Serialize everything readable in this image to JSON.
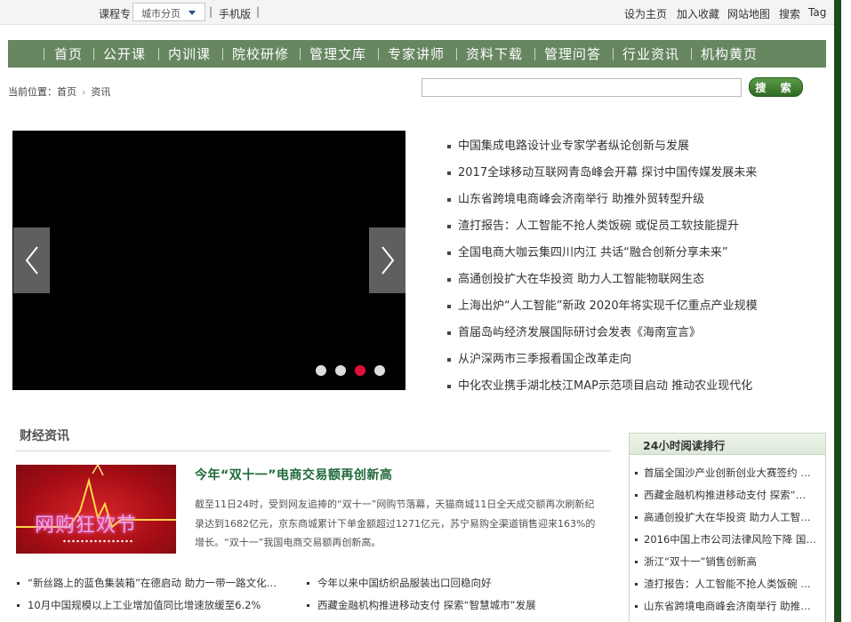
{
  "topbar": {
    "left_text": "课程专",
    "city_dropdown": "城市分页",
    "mobile": "手机版",
    "right_links": [
      "设为主页",
      "加入收藏",
      "网站地图",
      "搜索",
      "Tag"
    ]
  },
  "nav": {
    "items": [
      "首页",
      "公开课",
      "内训课",
      "院校研修",
      "管理文库",
      "专家讲师",
      "资料下载",
      "管理问答",
      "行业资讯",
      "机构黄页"
    ]
  },
  "breadcrumb": {
    "label": "当前位置：",
    "home": "首页",
    "current": "资讯"
  },
  "search": {
    "button": "搜 索"
  },
  "headlines": [
    "中国集成电路设计业专家学者纵论创新与发展",
    "2017全球移动互联网青岛峰会开幕 探讨中国传媒发展未来",
    "山东省跨境电商峰会济南举行 助推外贸转型升级",
    "渣打报告：人工智能不抢人类饭碗 或促员工软技能提升",
    "全国电商大咖云集四川内江 共话“融合创新分享未来”",
    "高通创投扩大在华投资 助力人工智能物联网生态",
    "上海出炉“人工智能”新政 2020年将实现千亿重点产业规模",
    "首届岛屿经济发展国际研讨会发表《海南宣言》",
    "从沪深两市三季报看国企改革走向",
    "中化农业携手湖北枝江MAP示范项目启动 推动农业现代化"
  ],
  "finance": {
    "section_title": "财经资讯",
    "image_text": "网购狂欢节",
    "feature_title": "今年“双十一”电商交易额再创新高",
    "feature_body": "截至11日24时，受到网友追捧的“双十一”网购节落幕，天猫商城11日全天成交额再次刷新纪录达到1682亿元，京东商城累计下单金额超过1271亿元，苏宁易购全渠道销售迎来163%的增长。“双十一”我国电商交易额再创新高。",
    "list_left": [
      "“新丝路上的蓝色集装箱”在德启动 助力一带一路文化…",
      "10月中国规模以上工业增加值同比增速放缓至6.2%"
    ],
    "list_right": [
      "今年以来中国纺织品服装出口回稳向好",
      "西藏金融机构推进移动支付 探索“智慧城市”发展"
    ]
  },
  "ranking": {
    "title": "24小时阅读排行",
    "items": [
      "首届全国沙产业创新创业大赛签约 …",
      "西藏金融机构推进移动支付 探索“…",
      "高通创投扩大在华投资 助力人工智…",
      "2016中国上市公司法律风险下降 国…",
      "浙江“双十一”销售创新高",
      "渣打报告：人工智能不抢人类饭碗 …",
      "山东省跨境电商峰会济南举行 助推…"
    ]
  },
  "slider": {
    "active_index": 2,
    "dot_count": 4,
    "dot_active_color": "#e0103a",
    "dot_color": "#dddddd"
  },
  "colors": {
    "nav_bg": "#66865f",
    "title_green": "#1f6a3a",
    "right_bar": "#1f4a1c"
  }
}
